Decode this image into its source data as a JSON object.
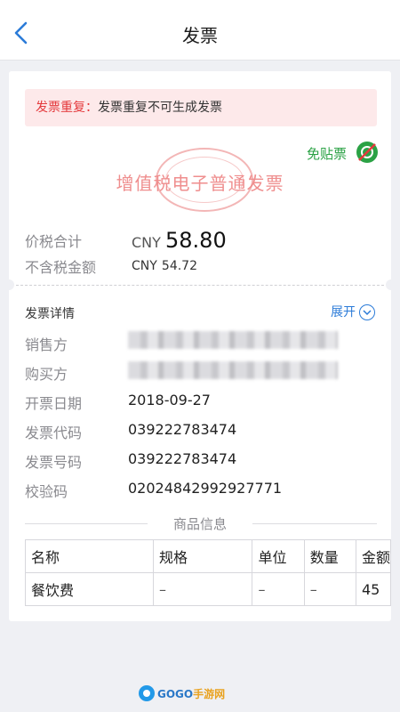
{
  "nav": {
    "title": "发票"
  },
  "notice": {
    "label": "发票重复：",
    "text": "发票重复不可生成发票"
  },
  "free_stamp": {
    "label": "免贴票"
  },
  "invoice_title": "增值税电子普通发票",
  "amounts": {
    "total_label": "价税合计",
    "total_currency": "CNY",
    "total_value": "58.80",
    "pretax_label": "不含税金额",
    "pretax_currency": "CNY",
    "pretax_value": "54.72"
  },
  "details": {
    "section_title": "发票详情",
    "expand_label": "展开",
    "rows": [
      {
        "label": "销售方",
        "value": ""
      },
      {
        "label": "购买方",
        "value": ""
      },
      {
        "label": "开票日期",
        "value": "2018-09-27"
      },
      {
        "label": "发票代码",
        "value": "039222783474"
      },
      {
        "label": "发票号码",
        "value": "039222783474"
      },
      {
        "label": "校验码",
        "value": "02024842992927771"
      }
    ]
  },
  "goods": {
    "section_title": "商品信息",
    "headers": [
      "名称",
      "规格",
      "单位",
      "数量",
      "金额"
    ],
    "rows": [
      [
        "餐饮费",
        "–",
        "–",
        "–",
        "45"
      ]
    ]
  },
  "watermark": {
    "brand_latin": "GOGO",
    "brand_cn": "手游网"
  },
  "colors": {
    "accent_blue": "#2b7bd8",
    "notice_red": "#e4393c",
    "stamp_red": "#ef8e8e",
    "free_green": "#2ba245"
  }
}
